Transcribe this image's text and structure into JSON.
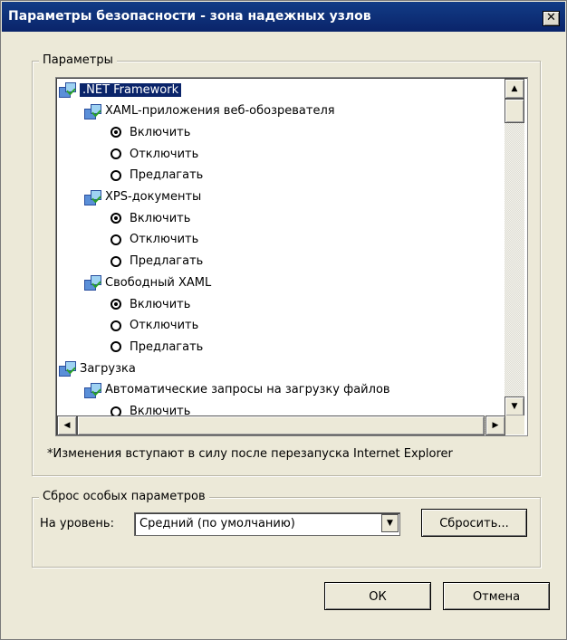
{
  "window": {
    "title": "Параметры безопасности - зона надежных узлов",
    "close_glyph": "✕"
  },
  "params": {
    "legend": "Параметры",
    "tree": [
      {
        "type": "node",
        "label": ".NET Framework",
        "selected": true
      },
      {
        "type": "node",
        "label": "XAML-приложения веб-обозревателя"
      },
      {
        "type": "radio",
        "label": "Включить",
        "checked": true
      },
      {
        "type": "radio",
        "label": "Отключить",
        "checked": false
      },
      {
        "type": "radio",
        "label": "Предлагать",
        "checked": false
      },
      {
        "type": "node",
        "label": "XPS-документы"
      },
      {
        "type": "radio",
        "label": "Включить",
        "checked": true
      },
      {
        "type": "radio",
        "label": "Отключить",
        "checked": false
      },
      {
        "type": "radio",
        "label": "Предлагать",
        "checked": false
      },
      {
        "type": "node",
        "label": "Свободный XAML"
      },
      {
        "type": "radio",
        "label": "Включить",
        "checked": true
      },
      {
        "type": "radio",
        "label": "Отключить",
        "checked": false
      },
      {
        "type": "radio",
        "label": "Предлагать",
        "checked": false
      },
      {
        "type": "node",
        "label": "Загрузка"
      },
      {
        "type": "node",
        "label": "Автоматические запросы на загрузку файлов"
      },
      {
        "type": "radio",
        "label": "Включить",
        "checked": false
      }
    ],
    "note": "*Изменения вступают в силу после перезапуска Internet Explorer"
  },
  "reset": {
    "legend": "Сброс особых параметров",
    "level_label": "На уровень:",
    "level_value": "Средний (по умолчанию)",
    "reset_button": "Сбросить..."
  },
  "buttons": {
    "ok": "ОК",
    "cancel": "Отмена"
  },
  "icons": {
    "node": "settings-node-icon",
    "scroll_up": "▲",
    "scroll_down": "▼",
    "scroll_left": "◀",
    "scroll_right": "▶",
    "combo_arrow": "▼"
  },
  "colors": {
    "titlebar": "#0a246a",
    "selection": "#0a246a",
    "dialog_bg": "#ece9d8"
  }
}
